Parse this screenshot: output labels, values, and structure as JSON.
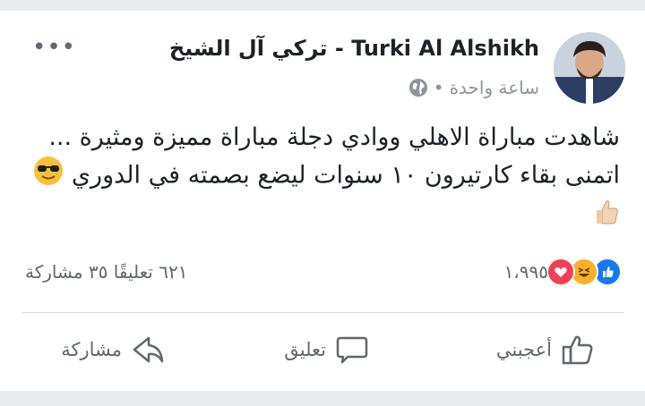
{
  "post": {
    "author": "Turki Al Alshikh - تركي آل الشيخ",
    "time": "ساعة واحدة",
    "separator": "•",
    "text_line1": "شاهدت  مباراة الاهلي ووادي دجلة مباراة مميزة ومثيرة ...",
    "text_line2": "اتمنى بقاء كارتيرون ١٠ سنوات ليضع بصمته في الدوري",
    "emojis": [
      "sunglasses-emoji",
      "thumbs-up-emoji"
    ]
  },
  "stats": {
    "reactions_count": "١،٩٩٥",
    "reactions": [
      "like",
      "haha",
      "love"
    ],
    "counts_text": "٦٢١ تعليقًا  ٣٥ مشاركة"
  },
  "actions": {
    "like": "أعجبني",
    "comment": "تعليق",
    "share": "مشاركة"
  },
  "colors": {
    "like_blue": "#1877f2",
    "love_red": "#f33e58",
    "haha_yellow": "#f7b125",
    "text": "#1d2129",
    "secondary": "#606770"
  },
  "more_label": "•••"
}
